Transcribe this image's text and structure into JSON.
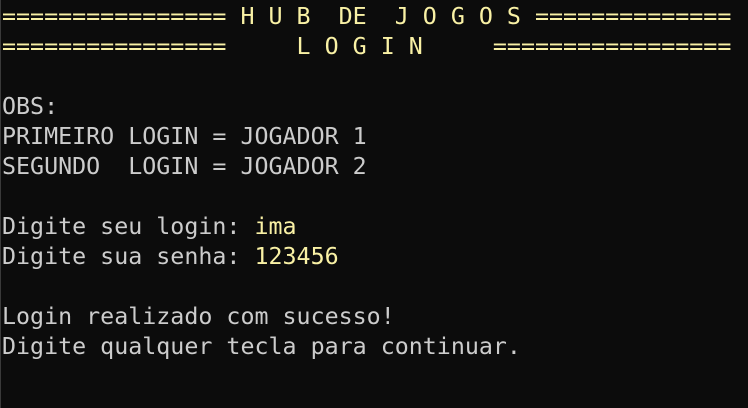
{
  "header": {
    "line1": "================ H U B  DE  J O G O S ==============",
    "line2": "================     L O G I N     ================="
  },
  "notes": {
    "title": "OBS:",
    "first": "PRIMEIRO LOGIN = JOGADOR 1",
    "second": "SEGUNDO  LOGIN = JOGADOR 2"
  },
  "form": {
    "login_prompt": "Digite seu login: ",
    "login_value": "ima",
    "password_prompt": "Digite sua senha: ",
    "password_value": "123456"
  },
  "messages": {
    "success": "Login realizado com sucesso!",
    "continue": "Digite qualquer tecla para continuar."
  },
  "colors": {
    "background": "#0c0c0c",
    "text": "#cccccc",
    "highlight": "#f9f1a5"
  }
}
